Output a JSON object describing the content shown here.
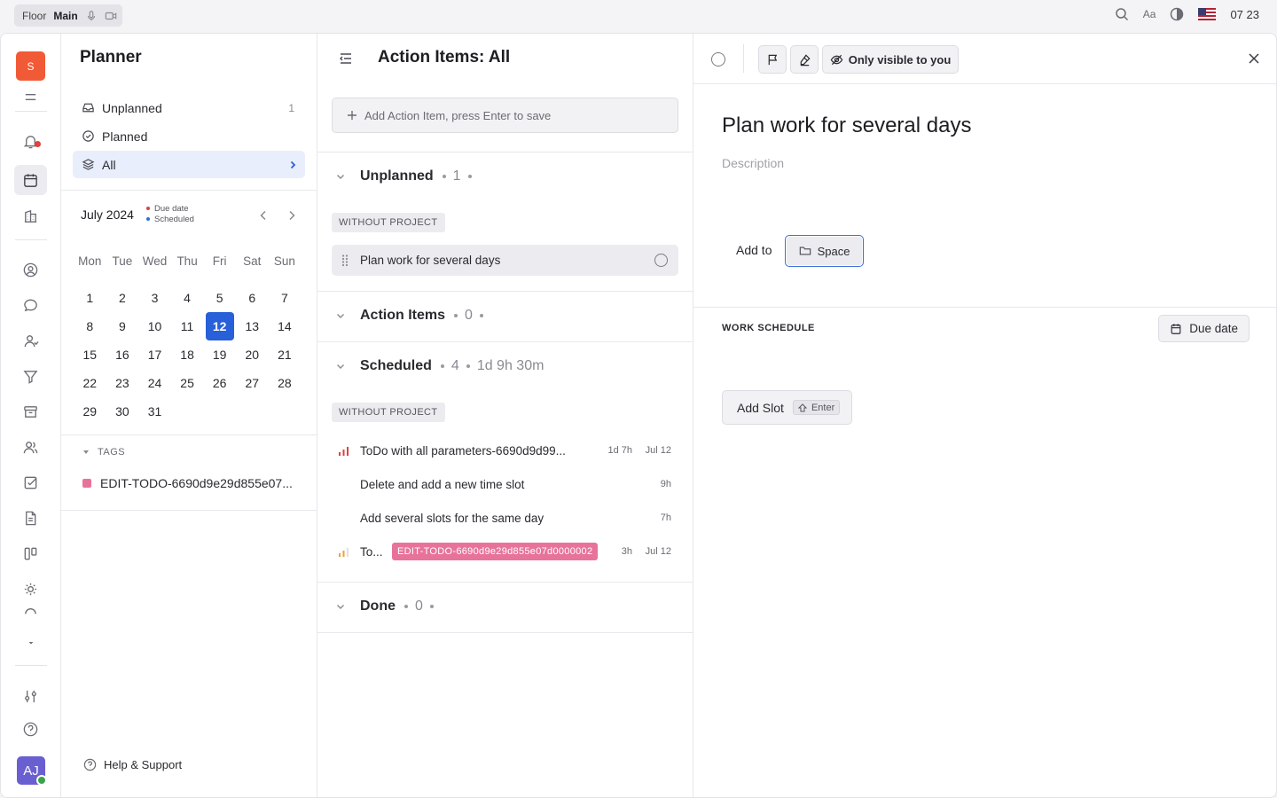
{
  "topbar": {
    "workspace_a": "Floor",
    "workspace_b": "Main",
    "time": "07 23",
    "font_label": "Aa",
    "icons": [
      "search-icon",
      "font-size-icon",
      "theme-contrast-icon",
      "us-flag-icon",
      "mic-icon",
      "video-icon"
    ]
  },
  "nav": {
    "logo_letter": "S",
    "avatar_initials": "AJ",
    "icons": [
      "menu-icon",
      "notifications-icon",
      "planner-icon",
      "office-icon",
      "contacts-icon",
      "chat-icon",
      "people-icon",
      "filter-icon",
      "archive-icon",
      "team-icon",
      "tasks-icon",
      "documents-icon",
      "board-icon",
      "sun-icon",
      "more-icon",
      "settings-sliders-icon",
      "help-icon"
    ]
  },
  "planner": {
    "title": "Planner",
    "items": [
      {
        "label": "Unplanned",
        "count": "1"
      },
      {
        "label": "Planned",
        "count": ""
      },
      {
        "label": "All",
        "count": ""
      }
    ],
    "calendar": {
      "month": "July 2024",
      "legend_due": "Due date",
      "legend_scheduled": "Scheduled",
      "weekdays": [
        "Mon",
        "Tue",
        "Wed",
        "Thu",
        "Fri",
        "Sat",
        "Sun"
      ],
      "weeks": [
        [
          "1",
          "2",
          "3",
          "4",
          "5",
          "6",
          "7"
        ],
        [
          "8",
          "9",
          "10",
          "11",
          "12",
          "13",
          "14"
        ],
        [
          "15",
          "16",
          "17",
          "18",
          "19",
          "20",
          "21"
        ],
        [
          "22",
          "23",
          "24",
          "25",
          "26",
          "27",
          "28"
        ],
        [
          "29",
          "30",
          "31",
          "",
          "",
          "",
          ""
        ]
      ],
      "today": "12"
    },
    "tags_header": "TAGS",
    "tags": [
      "EDIT-TODO-6690d9e29d855e07..."
    ],
    "help": "Help & Support"
  },
  "action_items": {
    "title": "Action Items: All",
    "add_placeholder": "Add Action Item, press Enter to save",
    "groups": {
      "unplanned": {
        "name": "Unplanned",
        "count": "1"
      },
      "action_items": {
        "name": "Action Items",
        "count": "0"
      },
      "scheduled": {
        "name": "Scheduled",
        "count": "4",
        "total": "1d 9h 30m"
      },
      "done": {
        "name": "Done",
        "count": "0"
      }
    },
    "project_badge": "WITHOUT PROJECT",
    "unplanned_task": "Plan work for several days",
    "scheduled_tasks": [
      {
        "title": "ToDo with all parameters-6690d9d99...",
        "duration": "1d 7h",
        "date": "Jul 12",
        "priority": "high"
      },
      {
        "title": "Delete and add a new time slot",
        "duration": "9h",
        "date": "",
        "priority": ""
      },
      {
        "title": "Add several slots for the same day",
        "duration": "7h",
        "date": "",
        "priority": ""
      },
      {
        "title": "To...",
        "tag": "EDIT-TODO-6690d9e29d855e07d0000002",
        "duration": "3h",
        "date": "Jul 12",
        "priority": "medium"
      }
    ]
  },
  "detail": {
    "visibility": "Only visible to you",
    "title": "Plan work for several days",
    "description_placeholder": "Description",
    "add_to_label": "Add to",
    "space_button": "Space",
    "work_schedule": "WORK SCHEDULE",
    "due_date_button": "Due date",
    "add_slot": "Add Slot",
    "enter_key": "Enter"
  },
  "colors": {
    "accent": "#2760d9",
    "logo": "#f15a36",
    "tag": "#e8739a",
    "priority_high": "#e04040",
    "priority_medium": "#f0a030"
  }
}
